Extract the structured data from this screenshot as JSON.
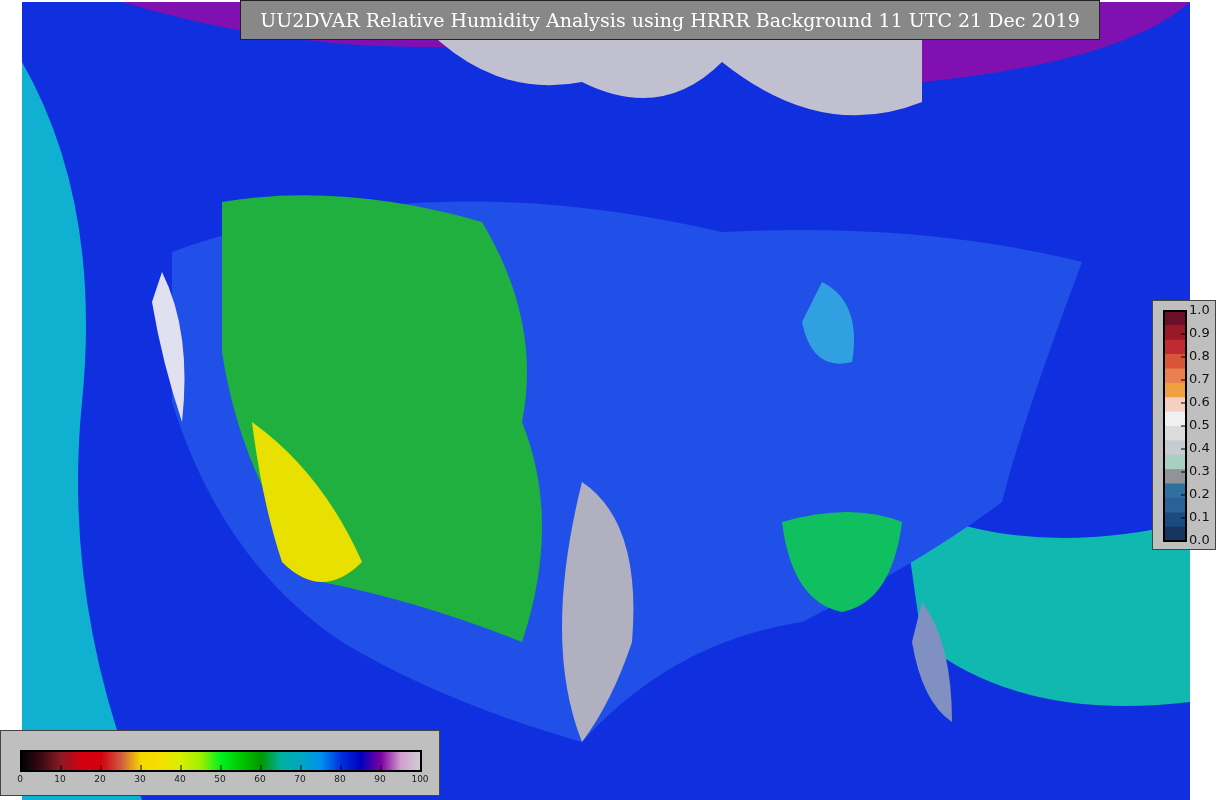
{
  "title": "UU2DVAR Relative Humidity Analysis using HRRR Background 11 UTC 21 Dec 2019",
  "humidity_colorbar": {
    "ticks": [
      "0",
      "10",
      "20",
      "30",
      "40",
      "50",
      "60",
      "70",
      "80",
      "90",
      "100"
    ]
  },
  "value_colorbar": {
    "ticks": [
      "1.0",
      "0.9",
      "0.8",
      "0.7",
      "0.6",
      "0.5",
      "0.4",
      "0.3",
      "0.2",
      "0.1",
      "0.0"
    ]
  }
}
